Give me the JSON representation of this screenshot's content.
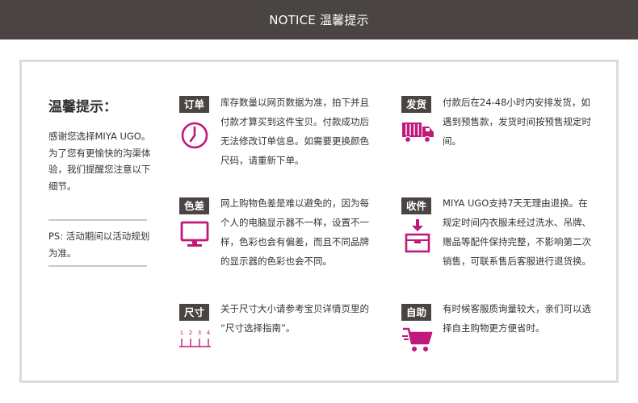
{
  "header": {
    "title": "NOTICE 温馨提示"
  },
  "intro": {
    "title": "温馨提示：",
    "text": "感谢您选择MIYA UGO。为了您有更愉快的沟渠体验，我们提醒您注意以下细节。",
    "ps": "PS: 活动期间以活动规划为准。"
  },
  "items": [
    {
      "tag": "订单",
      "icon": "clock-icon",
      "text": "库存数量以网页数据为准，拍下并且付款才算买到这件宝贝。付款成功后无法修改订单信息。如需要更换颜色尺码，请重新下单。"
    },
    {
      "tag": "发货",
      "icon": "delivery-truck-icon",
      "text": "付款后在24-48小时内安排发货，如遇到预售款，发货时间按预售规定时间。"
    },
    {
      "tag": "色差",
      "icon": "monitor-icon",
      "text": "网上购物色差是难以避免的，因为每个人的电脑显示器不一样，设置不一样，色彩也会有偏差，而且不同品牌的显示器的色彩也会不同。"
    },
    {
      "tag": "收件",
      "icon": "package-box-icon",
      "text": "MIYA UGO支持7天无理由退换。在规定时间内衣服未经过洗水、吊牌、赠品等配件保持完整，不影响第二次销售，可联系售后客服进行退货换。"
    },
    {
      "tag": "尺寸",
      "icon": "ruler-icon",
      "ruler_numbers": [
        "1",
        "2",
        "3",
        "4"
      ],
      "text": "关于尺寸大小请参考宝贝详情页里的 “尺寸选择指南”。"
    },
    {
      "tag": "自助",
      "icon": "shopping-cart-icon",
      "text": "有时候客服质询量较大，亲们可以选择自主购物更方便省时。"
    }
  ],
  "colors": {
    "accent": "#c0197b",
    "header_bg": "#4a4443",
    "tag_bg": "#4a4443",
    "border": "#dcdcdc"
  }
}
